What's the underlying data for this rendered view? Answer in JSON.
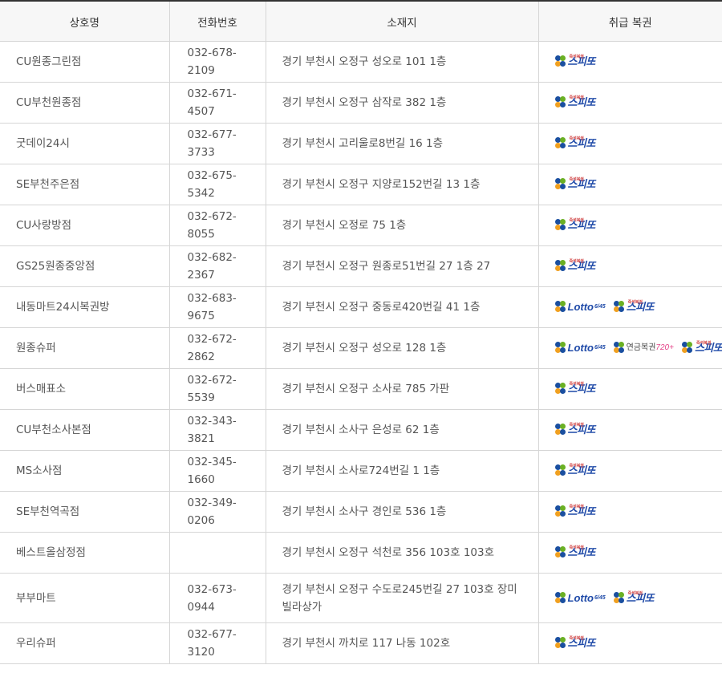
{
  "table": {
    "headers": [
      "상호명",
      "전화번호",
      "소재지",
      "취급 복권"
    ],
    "rows": [
      {
        "name": "CU원종그린점",
        "phone": "032-678-2109",
        "address": "경기 부천시 오정구 성오로 101 1층",
        "lotteries": [
          "speetto"
        ]
      },
      {
        "name": "CU부천원종점",
        "phone": "032-671-4507",
        "address": "경기 부천시 오정구 삼작로 382 1층",
        "lotteries": [
          "speetto"
        ]
      },
      {
        "name": "굿데이24시",
        "phone": "032-677-3733",
        "address": "경기 부천시 고리울로8번길 16 1층",
        "lotteries": [
          "speetto"
        ]
      },
      {
        "name": "SE부천주은점",
        "phone": "032-675-5342",
        "address": "경기 부천시 오정구 지양로152번길 13 1층",
        "lotteries": [
          "speetto"
        ]
      },
      {
        "name": "CU사랑방점",
        "phone": "032-672-8055",
        "address": "경기 부천시 오정로 75 1층",
        "lotteries": [
          "speetto"
        ]
      },
      {
        "name": "GS25원종중앙점",
        "phone": "032-682-2367",
        "address": "경기 부천시 오정구 원종로51번길 27 1층 27",
        "lotteries": [
          "speetto"
        ]
      },
      {
        "name": "내동마트24시복권방",
        "phone": "032-683-9675",
        "address": "경기 부천시 오정구 중동로420번길 41 1층",
        "lotteries": [
          "lotto645",
          "speetto"
        ]
      },
      {
        "name": "원종슈퍼",
        "phone": "032-672-2862",
        "address": "경기 부천시 오정구 성오로 128 1층",
        "lotteries": [
          "lotto645",
          "pension720",
          "speetto"
        ]
      },
      {
        "name": "버스매표소",
        "phone": "032-672-5539",
        "address": "경기 부천시 오정구 소사로 785 가판",
        "lotteries": [
          "speetto"
        ]
      },
      {
        "name": "CU부천소사본점",
        "phone": "032-343-3821",
        "address": "경기 부천시 소사구 은성로 62 1층",
        "lotteries": [
          "speetto"
        ]
      },
      {
        "name": "MS소사점",
        "phone": "032-345-1660",
        "address": "경기 부천시 소사로724번길 1 1층",
        "lotteries": [
          "speetto"
        ]
      },
      {
        "name": "SE부천역곡점",
        "phone": "032-349-0206",
        "address": "경기 부천시 소사구 경인로 536 1층",
        "lotteries": [
          "speetto"
        ]
      },
      {
        "name": "베스트올삼정점",
        "phone": "",
        "address": "경기 부천시 오정구 석천로 356 103호 103호",
        "lotteries": [
          "speetto"
        ]
      },
      {
        "name": "부부마트",
        "phone": "032-673-0944",
        "address": "경기 부천시 오정구 수도로245번길 27 103호 장미빌라상가",
        "lotteries": [
          "lotto645",
          "speetto"
        ]
      },
      {
        "name": "우리슈퍼",
        "phone": "032-677-3120",
        "address": "경기 부천시 까치로 117 나동 102호",
        "lotteries": [
          "speetto"
        ]
      }
    ]
  },
  "logos": {
    "speetto": {
      "text": "스피또",
      "sub": "즉석복권"
    },
    "lotto645": {
      "text": "Lotto",
      "sub": "6/45"
    },
    "pension720": {
      "text": "연금복권",
      "sub": "720+"
    }
  },
  "colors": {
    "brand_blue": "#1f4aa8",
    "pension_pink": "#e5468a",
    "border": "#d6d6d6",
    "header_bg": "#f7f7f7"
  }
}
